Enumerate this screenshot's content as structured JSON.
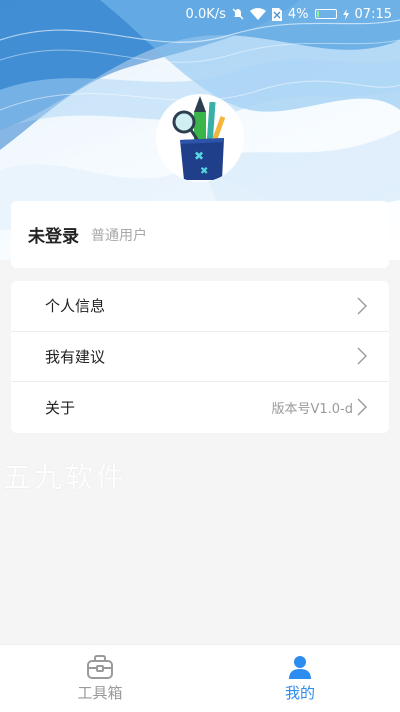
{
  "status_bar": {
    "network_speed": "0.0K/s",
    "battery_percent": "4%",
    "time": "07:15",
    "icons": [
      "mute-icon",
      "wifi-icon",
      "no-sim-icon",
      "battery-icon",
      "charging-icon"
    ]
  },
  "profile": {
    "avatar_icon": "pencil-cup-icon",
    "name": "未登录",
    "user_type": "普通用户"
  },
  "menu": {
    "items": [
      {
        "label": "个人信息",
        "value": ""
      },
      {
        "label": "我有建议",
        "value": ""
      },
      {
        "label": "关于",
        "value": "版本号V1.0-d"
      }
    ]
  },
  "watermark": "五九软件",
  "tabbar": {
    "tabs": [
      {
        "label": "工具箱",
        "icon": "toolbox-icon",
        "active": false
      },
      {
        "label": "我的",
        "icon": "person-icon",
        "active": true
      }
    ]
  },
  "colors": {
    "accent": "#2d8cf0",
    "inactive": "#9a9a9a",
    "hero_wave": "#5aa9e6"
  }
}
